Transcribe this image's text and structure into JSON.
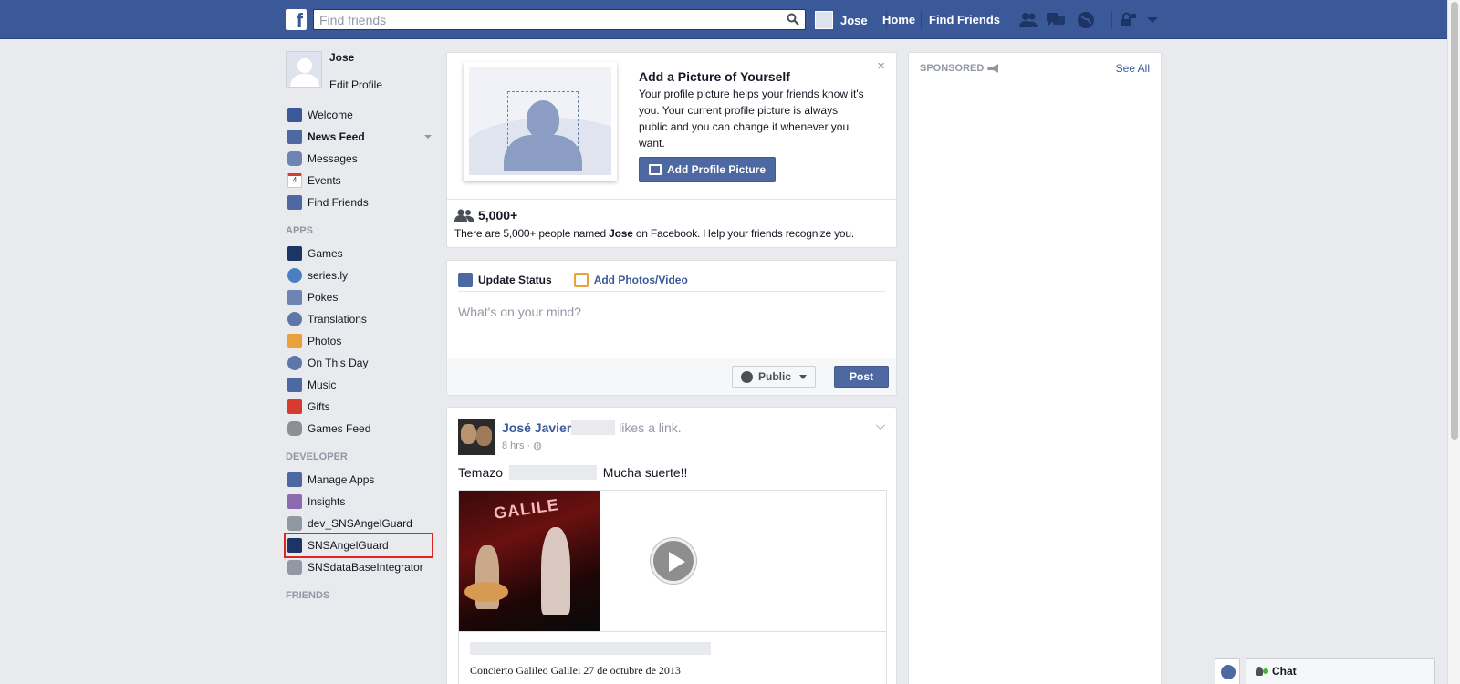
{
  "topbar": {
    "logo": "f",
    "search_placeholder": "Find friends",
    "user_name": "Jose",
    "home_label": "Home",
    "find_friends_label": "Find Friends",
    "icons": [
      "friend-requests-icon",
      "messages-icon",
      "notifications-icon",
      "privacy-shortcuts-icon",
      "account-menu-icon"
    ]
  },
  "sidebar": {
    "profile_name": "Jose",
    "edit_profile": "Edit Profile",
    "favorites": [
      {
        "label": "Welcome",
        "icon": "facebook-icon"
      },
      {
        "label": "News Feed",
        "icon": "news-feed-icon"
      },
      {
        "label": "Messages",
        "icon": "messages-icon"
      },
      {
        "label": "Events",
        "icon": "calendar-icon",
        "badge": "4"
      },
      {
        "label": "Find Friends",
        "icon": "find-friends-icon"
      }
    ],
    "apps_header": "APPS",
    "apps": [
      {
        "label": "Games",
        "icon": "games-icon"
      },
      {
        "label": "series.ly",
        "icon": "seriesly-icon"
      },
      {
        "label": "Pokes",
        "icon": "pokes-icon"
      },
      {
        "label": "Translations",
        "icon": "translations-icon"
      },
      {
        "label": "Photos",
        "icon": "photos-icon"
      },
      {
        "label": "On This Day",
        "icon": "on-this-day-icon"
      },
      {
        "label": "Music",
        "icon": "music-icon"
      },
      {
        "label": "Gifts",
        "icon": "gift-icon"
      },
      {
        "label": "Games Feed",
        "icon": "gamepad-icon"
      }
    ],
    "developer_header": "DEVELOPER",
    "developer": [
      {
        "label": "Manage Apps",
        "icon": "manage-apps-icon"
      },
      {
        "label": "Insights",
        "icon": "insights-icon"
      },
      {
        "label": "dev_SNSAngelGuard",
        "icon": "gear-icon"
      },
      {
        "label": "SNSAngelGuard",
        "icon": "angel-guard-icon"
      },
      {
        "label": "SNSdataBaseIntegrator",
        "icon": "gear-icon"
      }
    ],
    "friends_header": "FRIENDS"
  },
  "add_picture": {
    "title": "Add a Picture of Yourself",
    "description": "Your profile picture helps your friends know it's you. Your current profile picture is always public and you can change it whenever you want.",
    "button": "Add Profile Picture",
    "close": "×",
    "count": "5,000+",
    "named_prefix": "There are 5,000+ people named ",
    "named_name": "Jose",
    "named_suffix": " on Facebook. Help your friends recognize you."
  },
  "composer": {
    "tab_status": "Update Status",
    "tab_photos": "Add Photos/Video",
    "placeholder": "What's on your mind?",
    "audience": "Public",
    "post": "Post"
  },
  "story": {
    "author": "José Javier",
    "action": " likes a link.",
    "time": "8 hrs ·",
    "message_start": "Temazo ",
    "message_end": " Mucha suerte!!",
    "thumb_sign": "GALILE",
    "link_description": "Concierto Galileo Galilei 27 de octubre de 2013"
  },
  "sponsored": {
    "label": "SPONSORED",
    "see_all": "See All"
  },
  "chat": {
    "label": "Chat"
  }
}
